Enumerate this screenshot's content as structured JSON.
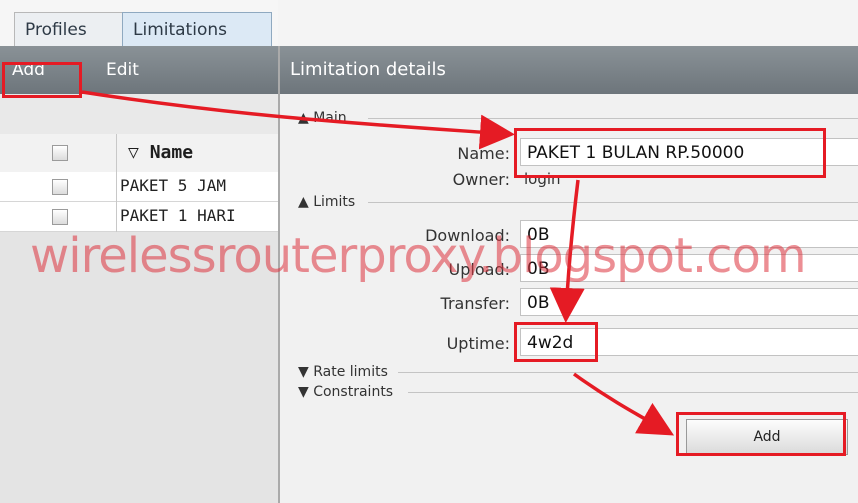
{
  "tabs": {
    "profiles": "Profiles",
    "limitations": "Limitations"
  },
  "toolbar": {
    "add": "Add",
    "edit": "Edit"
  },
  "table": {
    "header": "Name",
    "sort_icon": "▽",
    "rows": [
      "PAKET 5 JAM",
      "PAKET 1 HARI"
    ]
  },
  "detail": {
    "title": "Limitation details",
    "main_section": "Main",
    "limits_section": "Limits",
    "rate_limits_section": "Rate limits",
    "constraints_section": "Constraints",
    "fields": {
      "name_label": "Name:",
      "name_value": "PAKET 1 BULAN RP.50000",
      "owner_label": "Owner:",
      "owner_value": "login",
      "download_label": "Download:",
      "download_value": "0B",
      "upload_label": "Upload:",
      "upload_value": "0B",
      "transfer_label": "Transfer:",
      "transfer_value": "0B",
      "uptime_label": "Uptime:",
      "uptime_value": "4w2d"
    },
    "add_button": "Add"
  },
  "watermark": "wirelessrouterproxy.blogspot.com",
  "colors": {
    "highlight": "#e51b24",
    "toolbar": "#7b8389"
  }
}
